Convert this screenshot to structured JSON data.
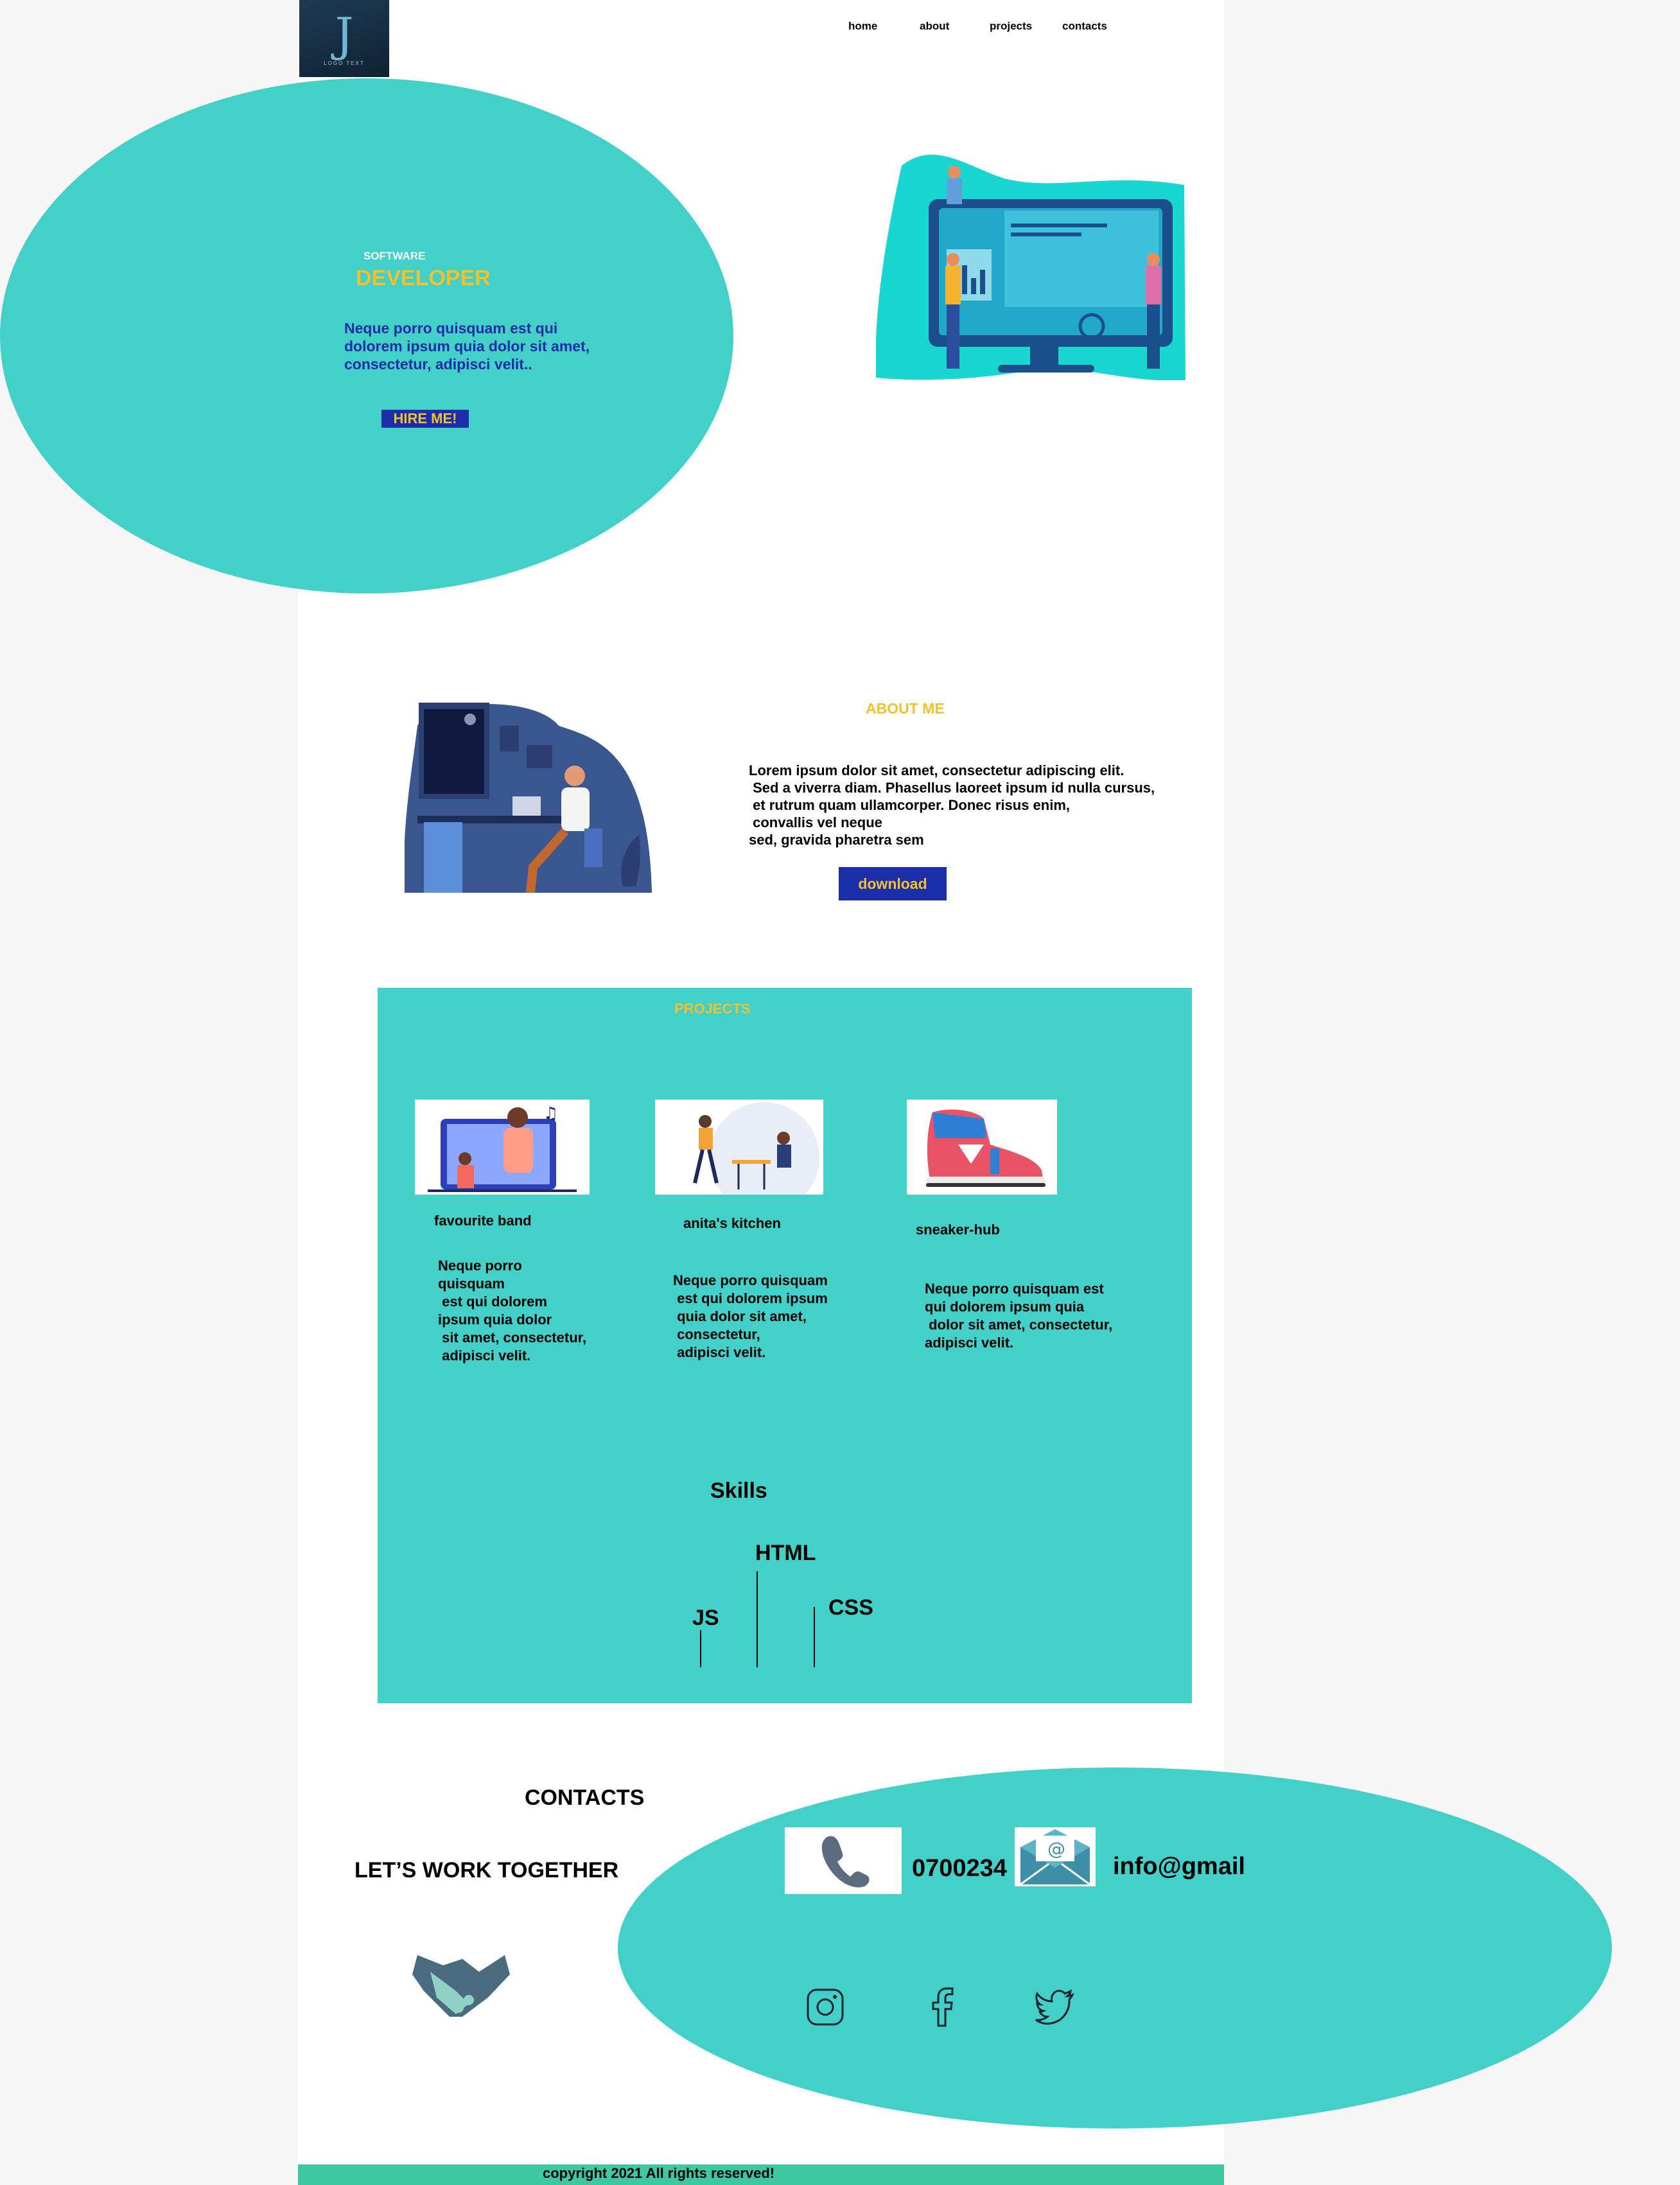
{
  "logo": {
    "mark": "J",
    "sub": "LOGO TEXT"
  },
  "nav": {
    "home": "home",
    "about": "about",
    "projects": "projects",
    "contacts": "contacts"
  },
  "hero": {
    "kicker": "SOFTWARE",
    "title": "DEVELOPER",
    "text": "Neque porro quisquam est qui dolorem ipsum quia dolor sit amet, consectetur, adipisci velit..",
    "button": "HIRE ME!"
  },
  "about": {
    "title": "ABOUT ME",
    "text": "Lorem ipsum dolor sit amet, consectetur adipiscing elit.\n Sed a viverra diam. Phasellus laoreet ipsum id nulla cursus,\n et rutrum quam ullamcorper. Donec risus enim,\n convallis vel neque\nsed, gravida pharetra sem",
    "button": "download"
  },
  "projects": {
    "title": "PROJECTS",
    "items": [
      {
        "name": "favourite band",
        "desc": "Neque porro\nquisquam\n est qui dolorem\nipsum quia dolor\n sit amet, consectetur,\n adipisci velit."
      },
      {
        "name": "anita's kitchen",
        "desc": "Neque porro quisquam\n est qui dolorem ipsum\n quia dolor sit amet,\n consectetur,\n adipisci velit."
      },
      {
        "name": "sneaker-hub",
        "desc": "Neque porro quisquam est\nqui dolorem ipsum quia\n dolor sit amet, consectetur,\nadipisci velit."
      }
    ]
  },
  "skills": {
    "title": "Skills",
    "html": "HTML",
    "js": "JS",
    "css": "CSS"
  },
  "contacts": {
    "title": "CONTACTS",
    "tagline": "LET’S WORK TOGETHER",
    "phone": "0700234",
    "email": "info@gmail"
  },
  "footer": {
    "text": "copyright 2021 All rights reserved!"
  },
  "colors": {
    "teal": "#42d0c8",
    "yellow": "#f2c12e",
    "navy": "#1b2ea8",
    "footer": "#3fc7a0"
  }
}
